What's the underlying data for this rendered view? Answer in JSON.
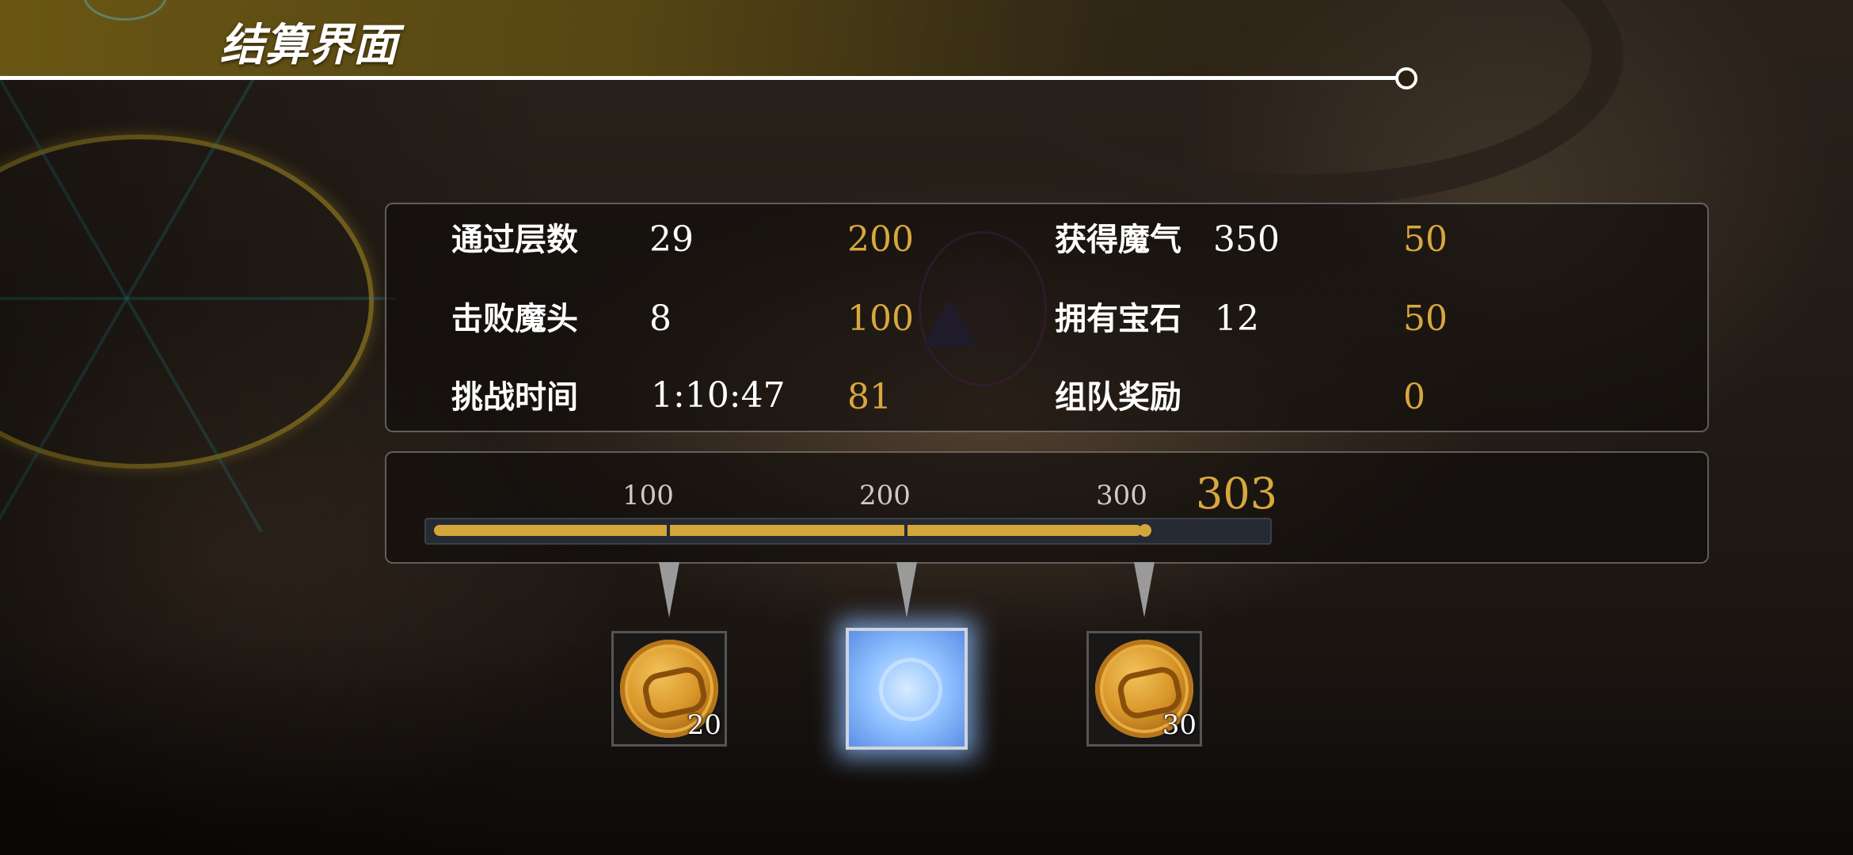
{
  "header": {
    "title": "结算界面"
  },
  "stats": {
    "rows": [
      {
        "label": "通过层数",
        "value": "29",
        "score": "200",
        "label2": "获得魔气",
        "value2": "350",
        "score2": "50"
      },
      {
        "label": "击败魔头",
        "value": "8",
        "score": "100",
        "label2": "拥有宝石",
        "value2": "12",
        "score2": "50"
      },
      {
        "label": "挑战时间",
        "value": "1:10:47",
        "score": "81",
        "label2": "组队奖励",
        "value2": "",
        "score2": "0"
      }
    ]
  },
  "progress": {
    "milestones": [
      "100",
      "200",
      "300"
    ],
    "total": "303",
    "current": 303,
    "max": 353
  },
  "rewards": [
    {
      "type": "coin",
      "count": "20"
    },
    {
      "type": "glowing-item",
      "count": ""
    },
    {
      "type": "coin",
      "count": "30"
    }
  ],
  "colors": {
    "accent_gold": "#d8a83e",
    "header_band": "#6e5a14",
    "glow": "#8fc0ff"
  }
}
